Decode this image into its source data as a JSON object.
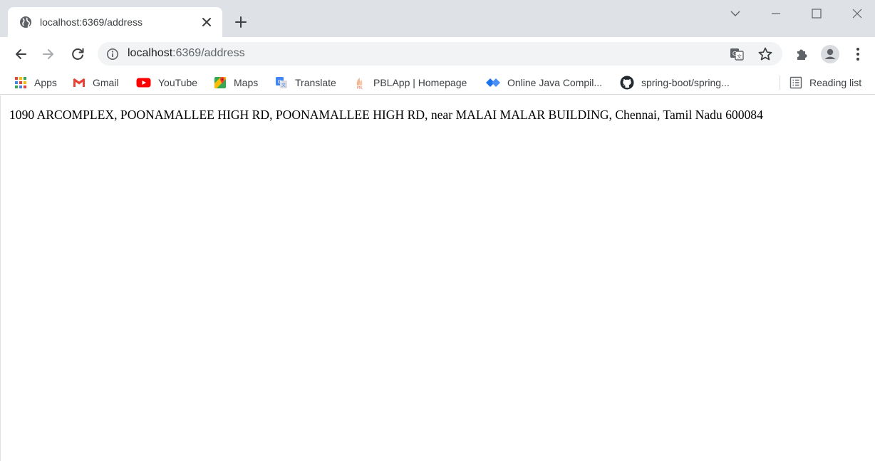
{
  "window": {
    "tab": {
      "title": "localhost:6369/address",
      "favicon": "globe-icon"
    }
  },
  "toolbar": {
    "url_host": "localhost",
    "url_path": ":6369/address"
  },
  "bookmarks": {
    "items": [
      {
        "label": "Apps",
        "icon": "apps-grid-icon"
      },
      {
        "label": "Gmail",
        "icon": "gmail-icon"
      },
      {
        "label": "YouTube",
        "icon": "youtube-icon"
      },
      {
        "label": "Maps",
        "icon": "maps-icon"
      },
      {
        "label": "Translate",
        "icon": "translate-icon"
      },
      {
        "label": "PBLApp | Homepage",
        "icon": "pblapp-icon"
      },
      {
        "label": "Online Java Compil...",
        "icon": "jdoodle-icon"
      },
      {
        "label": "spring-boot/spring...",
        "icon": "github-icon"
      }
    ],
    "reading_list": "Reading list"
  },
  "page": {
    "address": "1090 ARCOMPLEX, POONAMALLEE HIGH RD, POONAMALLEE HIGH RD, near MALAI MALAR BUILDING, Chennai, Tamil Nadu 600084"
  },
  "colors": {
    "titlebar_bg": "#dee1e6",
    "omnibox_bg": "#f1f3f4",
    "youtube_red": "#ff0000",
    "jdoodle_blue": "#1a73e8"
  }
}
